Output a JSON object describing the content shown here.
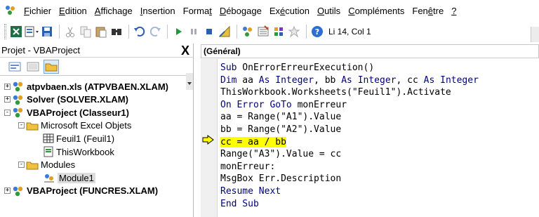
{
  "menu": [
    {
      "label": "Fichier",
      "underline_index": 0
    },
    {
      "label": "Edition",
      "underline_index": 0
    },
    {
      "label": "Affichage",
      "underline_index": 0
    },
    {
      "label": "Insertion",
      "underline_index": 0
    },
    {
      "label": "Format",
      "underline_index": 5
    },
    {
      "label": "Débogage",
      "underline_index": 0
    },
    {
      "label": "Exécution",
      "underline_index": 2
    },
    {
      "label": "Outils",
      "underline_index": 0
    },
    {
      "label": "Compléments",
      "underline_index": 0
    },
    {
      "label": "Fenêtre",
      "underline_index": 3
    },
    {
      "label": "?",
      "underline_index": 0
    }
  ],
  "toolbar": {
    "cursor_position": "Li 14, Col 1",
    "icons": [
      "excel-icon",
      "insert-module-icon",
      "save-icon",
      "cut-icon",
      "copy-icon",
      "paste-icon",
      "find-icon",
      "undo-icon",
      "redo-icon",
      "run-icon",
      "break-icon",
      "reset-icon",
      "design-mode-icon",
      "project-explorer-icon",
      "properties-icon",
      "object-browser-icon",
      "toolbox-icon",
      "help-icon"
    ]
  },
  "explorer": {
    "title": "Projet - VBAProject",
    "close_label": "X",
    "tree": [
      {
        "label": "atpvbaen.xls (ATPVBAEN.XLAM)",
        "bold": true,
        "level": 0,
        "expander": "+"
      },
      {
        "label": "Solver (SOLVER.XLAM)",
        "bold": true,
        "level": 0,
        "expander": "+"
      },
      {
        "label": "VBAProject (Classeur1)",
        "bold": true,
        "level": 0,
        "expander": "−"
      },
      {
        "label": "Microsoft Excel Objets",
        "bold": false,
        "level": 1,
        "expander": "−"
      },
      {
        "label": "Feuil1 (Feuil1)",
        "bold": false,
        "level": 2,
        "expander": ""
      },
      {
        "label": "ThisWorkbook",
        "bold": false,
        "level": 2,
        "expander": ""
      },
      {
        "label": "Modules",
        "bold": false,
        "level": 1,
        "expander": "−"
      },
      {
        "label": "Module1",
        "bold": false,
        "level": 2,
        "expander": "",
        "selected": true
      },
      {
        "label": "VBAProject (FUNCRES.XLAM)",
        "bold": true,
        "level": 0,
        "expander": "+"
      }
    ]
  },
  "code_pane": {
    "object_selector": "(Général)",
    "lines": [
      [
        {
          "t": "Sub",
          "k": true
        },
        {
          "t": " OnErrorErreurExecution()",
          "k": false
        }
      ],
      [
        {
          "t": "Dim",
          "k": true
        },
        {
          "t": " aa ",
          "k": false
        },
        {
          "t": "As",
          "k": true
        },
        {
          "t": " ",
          "k": false
        },
        {
          "t": "Integer",
          "k": true
        },
        {
          "t": ", bb ",
          "k": false
        },
        {
          "t": "As",
          "k": true
        },
        {
          "t": " ",
          "k": false
        },
        {
          "t": "Integer",
          "k": true
        },
        {
          "t": ", cc ",
          "k": false
        },
        {
          "t": "As",
          "k": true
        },
        {
          "t": " ",
          "k": false
        },
        {
          "t": "Integer",
          "k": true
        }
      ],
      [
        {
          "t": "ThisWorkbook.Worksheets(\"Feuil1\").Activate",
          "k": false
        }
      ],
      [
        {
          "t": "On Error GoTo",
          "k": true
        },
        {
          "t": " monErreur",
          "k": false
        }
      ],
      [
        {
          "t": "aa = Range(\"A1\").Value",
          "k": false
        }
      ],
      [
        {
          "t": "bb = Range(\"A2\").Value",
          "k": false
        }
      ],
      [
        {
          "t": "cc = aa / bb",
          "k": false,
          "highlight": true
        }
      ],
      [
        {
          "t": "Range(\"A3\").Value = cc",
          "k": false
        }
      ],
      [
        {
          "t": "monErreur:",
          "k": false
        }
      ],
      [
        {
          "t": "MsgBox Err.Description",
          "k": false
        }
      ],
      [
        {
          "t": "Resume Next",
          "k": true
        }
      ],
      [
        {
          "t": "End Sub",
          "k": true
        }
      ]
    ],
    "current_line_index": 6,
    "colors": {
      "keyword": "#00007f",
      "highlight": "#ffff00",
      "arrow": "#ffff00"
    }
  }
}
